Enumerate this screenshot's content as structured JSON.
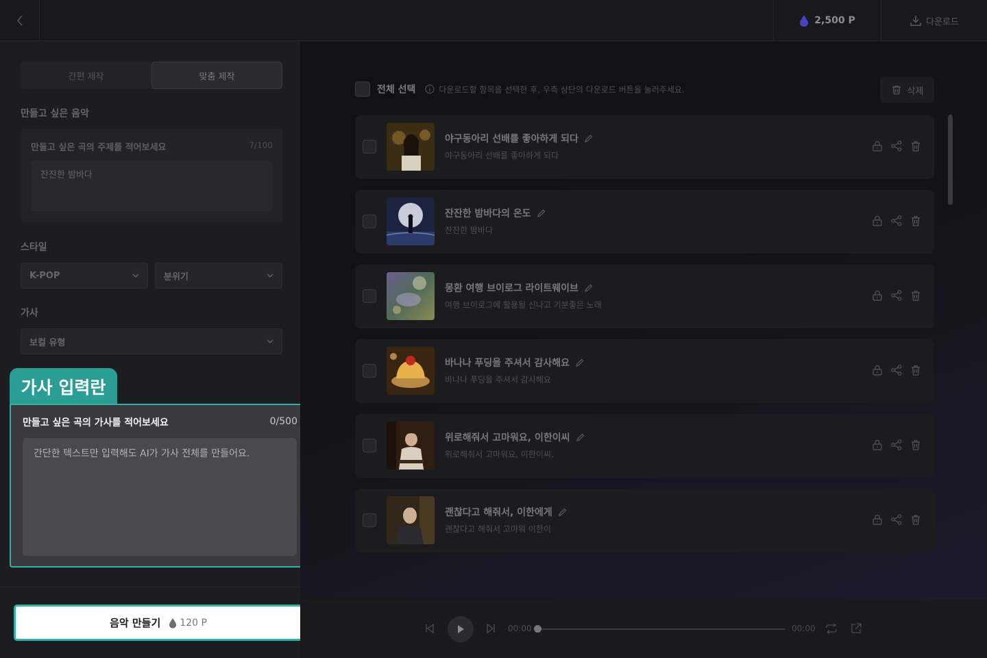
{
  "topbar": {
    "points": "2,500 P",
    "download_label": "다운로드"
  },
  "left": {
    "tabs": [
      {
        "label": "간편 제작",
        "active": false
      },
      {
        "label": "맞춤 제작",
        "active": true
      }
    ],
    "music_section": "만들고 싶은 음악",
    "theme_label": "만들고 싶은 곡의 주제를 적어보세요",
    "theme_count": "7/100",
    "theme_value": "잔잔한 밤바다",
    "style_section": "스타일",
    "genre_value": "K-POP",
    "mood_value": "분위기",
    "lyrics_section": "가사",
    "vocal_value": "보컬 유형",
    "lyrics_tag": "가사 입력란",
    "lyrics_label": "만들고 싶은 곡의 가사를 적어보세요",
    "lyrics_count": "0/500",
    "lyrics_placeholder": "간단한 텍스트만 입력해도 AI가 가사 전체를 만들어요."
  },
  "create": {
    "label": "음악 만들기",
    "cost": "120 P"
  },
  "list": {
    "select_all": "전체 선택",
    "hint": "다운로드할 항목을 선택한 후, 우측 상단의 다운로드 버튼을 눌러주세요.",
    "delete_label": "삭제",
    "songs": [
      {
        "title": "야구동아리 선배를 좋아하게 되다",
        "subtitle": "야구동아리 선배를 좋아하게 되다",
        "thumb": "girl"
      },
      {
        "title": "잔잔한 밤바다의 온도",
        "subtitle": "잔잔한 밤바다",
        "thumb": "moon"
      },
      {
        "title": "몽환 여행 브이로그 라이트웨이브",
        "subtitle": "여행 브이로그에 활용될 신나고 기분좋은 노래",
        "thumb": "dream"
      },
      {
        "title": "바나나 푸딩을 주셔서 감사해요",
        "subtitle": "바나나 푸딩을 주셔서 감사해요",
        "thumb": "pudding"
      },
      {
        "title": "위로해줘서 고마워요, 이한이씨",
        "subtitle": "위로해줘서 고마워요, 이한이씨.",
        "thumb": "boy-piano"
      },
      {
        "title": "괜찮다고 해줘서, 이한에게",
        "subtitle": "괜찮다고 해줘서 고마워 이한이",
        "thumb": "boy"
      }
    ]
  },
  "player": {
    "current_time": "00:00",
    "total_time": "00:00",
    "progress": 0
  },
  "colors": {
    "accent": "#32b3a8",
    "tag": "#2a9d95",
    "point_drop": "#5b4fd8"
  }
}
